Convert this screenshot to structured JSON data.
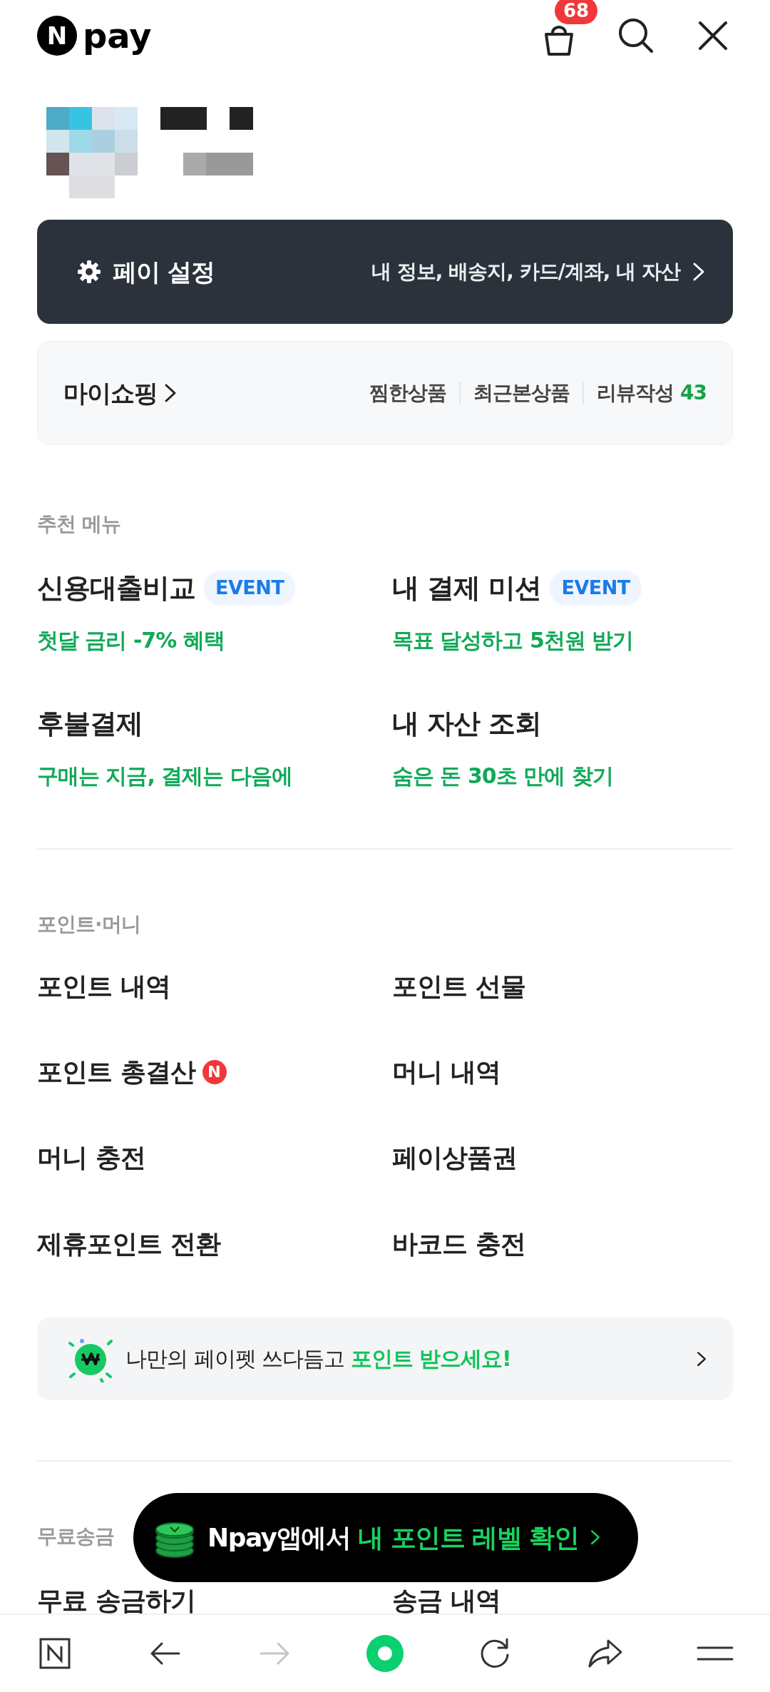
{
  "header": {
    "logo_letter": "N",
    "logo_text": "pay",
    "cart_count": "68"
  },
  "pay_settings": {
    "title": "페이 설정",
    "links": "내 정보, 배송지, 카드/계좌, 내 자산"
  },
  "my_shopping": {
    "title": "마이쇼핑",
    "links": [
      "찜한상품",
      "최근본상품"
    ],
    "review_label": "리뷰작성",
    "review_count": "43"
  },
  "sections": [
    {
      "title": "추천 메뉴",
      "kind": "featured",
      "items": [
        {
          "title": "신용대출비교",
          "badge": "EVENT",
          "subtitle": "첫달 금리 -7% 혜택"
        },
        {
          "title": "내 결제 미션",
          "badge": "EVENT",
          "subtitle": "목표 달성하고 5천원 받기"
        },
        {
          "title": "후불결제",
          "subtitle": "구매는 지금, 결제는 다음에"
        },
        {
          "title": "내 자산 조회",
          "subtitle": "숨은 돈 30초 만에 찾기"
        }
      ]
    },
    {
      "title": "포인트·머니",
      "kind": "plain",
      "items": [
        {
          "title": "포인트 내역"
        },
        {
          "title": "포인트 선물"
        },
        {
          "title": "포인트 총결산",
          "new_mark": "N"
        },
        {
          "title": "머니 내역"
        },
        {
          "title": "머니 충전"
        },
        {
          "title": "페이상품권"
        },
        {
          "title": "제휴포인트 전환"
        },
        {
          "title": "바코드 충전"
        }
      ]
    }
  ],
  "promo_banner": {
    "text": "나만의 페이펫 쓰다듬고",
    "highlight": "포인트 받으세요!"
  },
  "send_section": {
    "title": "무료송금",
    "items": [
      "무료 송금하기",
      "송금 내역"
    ]
  },
  "floating_pill": {
    "text": "Npay앱에서",
    "highlight": "내 포인트 레벨 확인"
  },
  "bottom_nav": [
    {
      "kind": "naver",
      "disabled": false
    },
    {
      "kind": "back",
      "disabled": false
    },
    {
      "kind": "forward",
      "disabled": true
    },
    {
      "kind": "home",
      "disabled": false
    },
    {
      "kind": "refresh",
      "disabled": false
    },
    {
      "kind": "share",
      "disabled": false
    },
    {
      "kind": "menu",
      "disabled": false
    }
  ]
}
